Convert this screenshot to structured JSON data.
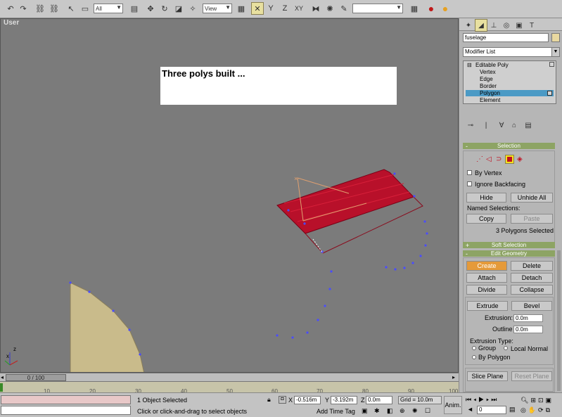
{
  "toolbar": {
    "selection_filter": "All",
    "reference_coord": "View",
    "icons": [
      "undo-icon",
      "redo-icon",
      "link-icon",
      "unlink-icon",
      "bind-space-warp-icon",
      "select-icon",
      "select-region-icon",
      "select-by-name-icon",
      "move-icon",
      "rotate-icon",
      "scale-icon",
      "select-manipulate-icon",
      "pivot-icon",
      "axis-x-icon",
      "axis-y-icon",
      "axis-z-icon",
      "axis-xy-icon",
      "mirror-icon",
      "align-icon",
      "snap-icon",
      "named-selection-icon",
      "material-editor-icon",
      "render-icon"
    ]
  },
  "viewport": {
    "label": "User",
    "caption": "Three polys built ...",
    "axis_x": "x",
    "axis_z": "z"
  },
  "command_panel": {
    "tab_icons": [
      "create-icon",
      "modify-icon",
      "hierarchy-icon",
      "motion-icon",
      "display-icon",
      "utilities-icon"
    ],
    "object_name": "fuselage",
    "object_color": "#e8d8a0",
    "modifier_list": "Modifier List",
    "stack": {
      "root": "Editable Poly",
      "items": [
        "Vertex",
        "Edge",
        "Border",
        "Polygon",
        "Element"
      ],
      "selected": "Polygon"
    },
    "selection": {
      "title": "Selection",
      "by_vertex": "By Vertex",
      "ignore_backfacing": "Ignore Backfacing",
      "hide": "Hide",
      "unhide_all": "Unhide All",
      "named_selections": "Named Selections:",
      "copy": "Copy",
      "paste": "Paste",
      "status": "3 Polygons Selected"
    },
    "soft_selection": "Soft Selection",
    "edit_geometry": {
      "title": "Edit Geometry",
      "create": "Create",
      "delete": "Delete",
      "attach": "Attach",
      "detach": "Detach",
      "divide": "Divide",
      "collapse": "Collapse",
      "extrude": "Extrude",
      "bevel": "Bevel",
      "extrusion_label": "Extrusion:",
      "extrusion_value": "0.0m",
      "outline_label": "Outline",
      "outline_value": "0.0m",
      "extrusion_type": "Extrusion Type:",
      "group": "Group",
      "local_normal": "Local Normal",
      "by_polygon": "By Polygon",
      "slice_plane": "Slice Plane",
      "reset_plane": "Reset Plane"
    }
  },
  "timeline": {
    "slider": "0 / 100",
    "ticks": [
      "10",
      "20",
      "30",
      "40",
      "50",
      "60",
      "70",
      "80",
      "90",
      "100"
    ]
  },
  "status": {
    "selected": "1 Object Selected",
    "prompt": "Click or click-and-drag to select objects",
    "x_label": "X",
    "x": "-0.516m",
    "y_label": "Y",
    "y": "-3.192m",
    "z_label": "Z",
    "z": "0.0m",
    "grid": "Grid = 10.0m",
    "add_time_tag": "Add Time Tag",
    "anim": "Anim.",
    "frame": "0"
  }
}
